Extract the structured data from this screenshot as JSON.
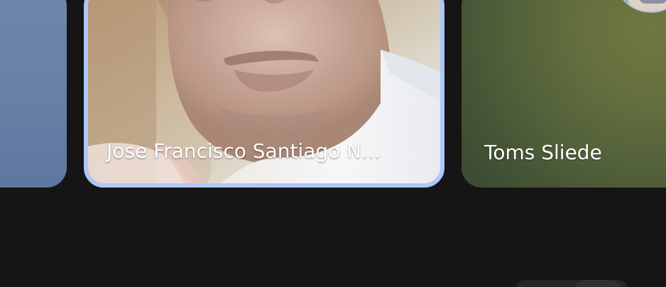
{
  "participants": [
    {
      "name": "",
      "tile_color": "#6f86ad"
    },
    {
      "name": "Jose Francisco Santiago N...",
      "highlight_color": "#aec6f9"
    },
    {
      "name": "Toms Sliede",
      "tile_color": "#52613a"
    }
  ],
  "icons": [
    "avatar"
  ]
}
